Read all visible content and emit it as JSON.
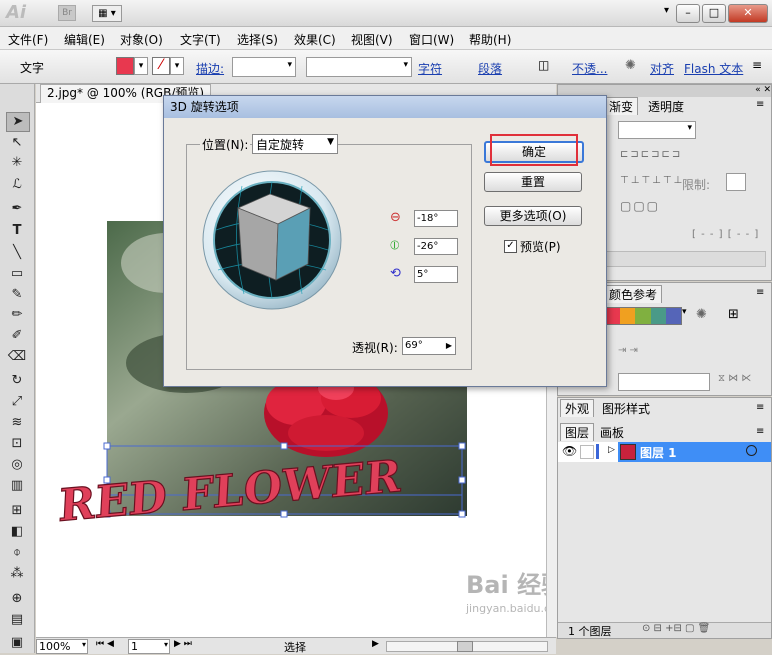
{
  "app": {
    "logo_text": "Ai",
    "bridge_text": "Br"
  },
  "menu": [
    "文件(F)",
    "编辑(E)",
    "对象(O)",
    "文字(T)",
    "选择(S)",
    "效果(C)",
    "视图(V)",
    "窗口(W)",
    "帮助(H)"
  ],
  "control": {
    "mode_label": "文字",
    "stroke_label": "描边:",
    "char_link": "字符",
    "para_link": "段落",
    "opacity_link": "不透...",
    "align_link": "对齐",
    "flash_link": "Flash 文本",
    "fill_color": "#e8384f"
  },
  "document": {
    "tab_title": "2.jpg* @ 100% (RGB/预览)",
    "zoom": "100%",
    "page": "1",
    "status": "选择",
    "art_text": "RED FLOWER",
    "art_color": "#e0405a"
  },
  "panels": {
    "top_tabs": [
      "渐变",
      "透明度"
    ],
    "limit_label": "限制:",
    "color_guide_tab": "颜色参考",
    "appearance_tabs": [
      "外观",
      "图形样式"
    ],
    "layers_tabs": [
      "图层",
      "画板"
    ],
    "layer_name": "图层 1",
    "layer_count": "1 个图层",
    "swatches": [
      "#e8384f",
      "#f0a020",
      "#80b040",
      "#4a9a88",
      "#5565b8"
    ]
  },
  "dialog": {
    "title": "3D 旋转选项",
    "position_label": "位置(N):",
    "position_value": "自定旋转",
    "x_rot": "-18°",
    "y_rot": "-26°",
    "z_rot": "5°",
    "perspective_label": "透视(R):",
    "perspective_value": "69°",
    "ok": "确定",
    "reset": "重置",
    "more": "更多选项(O)",
    "preview": "预览(P)",
    "preview_checked": true,
    "cube_front": "#5a9fb5",
    "cube_top": "#d4d4d4",
    "cube_side": "#a6a6a6"
  },
  "watermark": {
    "brand": "Bai 经验",
    "url": "jingyan.baidu.com"
  }
}
